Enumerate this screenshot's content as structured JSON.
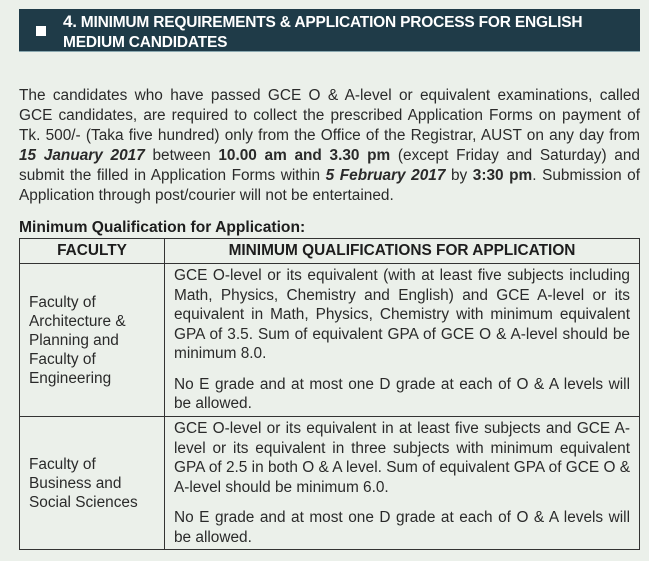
{
  "header": {
    "number": "4.",
    "title": "MINIMUM REQUIREMENTS & APPLICATION PROCESS FOR ENGLISH MEDIUM CANDIDATES"
  },
  "intro": {
    "t1": "The candidates who have passed GCE O & A-level or equivalent examinations, called GCE candidates, are required to collect the prescribed Application Forms on payment of Tk. 500/- (Taka five hundred) only from the Office of the Registrar, AUST on any day from ",
    "date_start": "15 January 2017",
    "t2": " between ",
    "time_range": "10.00 am and 3.30 pm",
    "t3": " (except Friday and Saturday) and submit the filled in Application Forms within ",
    "date_end": "5 February 2017",
    "t4": " by ",
    "time_end": "3:30 pm",
    "t5": ".  Submission of Application through post/courier will not be entertained."
  },
  "subheading": "Minimum Qualification for Application:",
  "table": {
    "col_faculty": "FACULTY",
    "col_qual": "MINIMUM QUALIFICATIONS FOR APPLICATION",
    "rows": [
      {
        "faculty_lines": [
          "Faculty of",
          "Architecture &",
          "Planning and",
          "Faculty of",
          "Engineering"
        ],
        "req": "GCE O-level or its equivalent (with at least five subjects including Math, Physics, Chemistry and English) and GCE A-level or its equivalent in Math, Physics, Chemistry with minimum equivalent GPA of 3.5. Sum of equivalent GPA of GCE O & A-level should be minimum 8.0.",
        "note": "No E grade and at most one D grade at each of O & A levels will be allowed."
      },
      {
        "faculty_lines": [
          "Faculty of",
          "Business and",
          "Social Sciences"
        ],
        "req": "GCE O-level or its equivalent in at least five subjects and GCE A-level or its equivalent in three subjects with minimum equivalent GPA of 2.5 in both O & A level. Sum of equivalent GPA of GCE O & A-level should be minimum 6.0.",
        "note": "No E grade and at most one D grade at each of O & A levels will be allowed."
      }
    ]
  }
}
